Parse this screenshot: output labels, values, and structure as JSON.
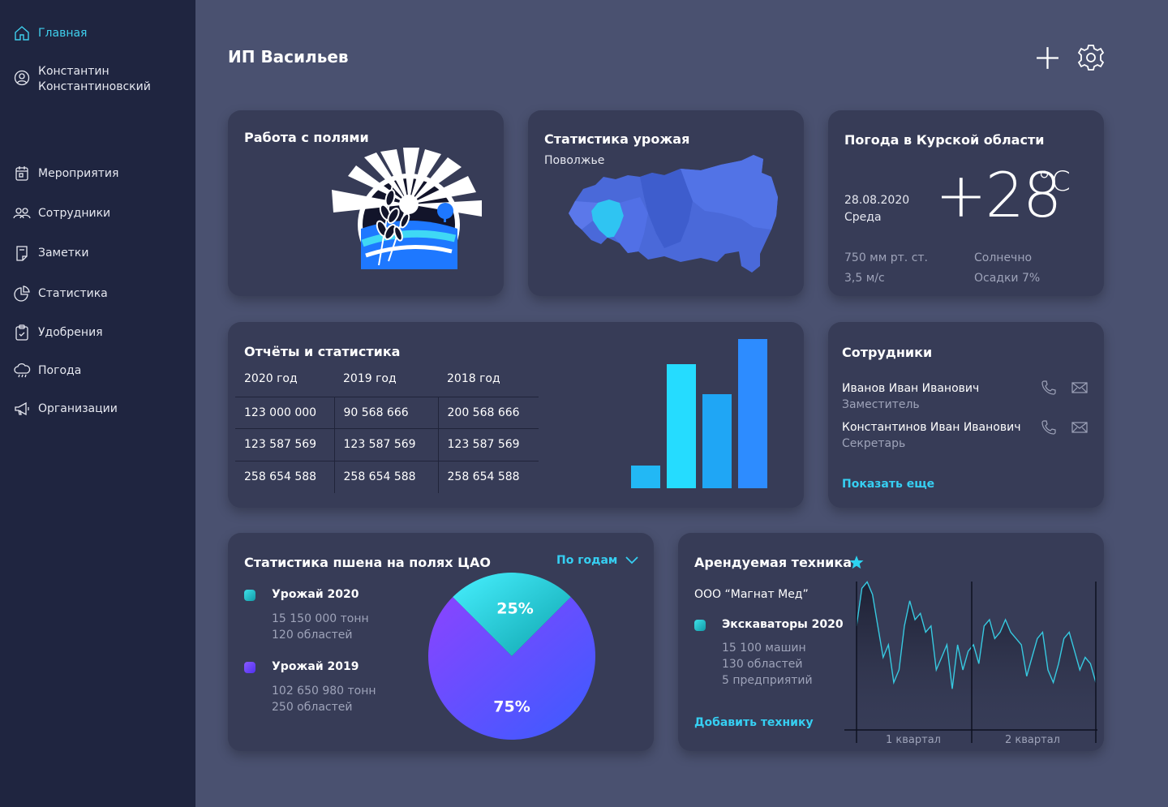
{
  "sidebar": {
    "home": "Главная",
    "user_line1": "Константин",
    "user_line2": "Константиновский",
    "items": [
      {
        "label": "Мероприятия"
      },
      {
        "label": "Сотрудники"
      },
      {
        "label": "Заметки"
      },
      {
        "label": "Статистика"
      },
      {
        "label": "Удобрения"
      },
      {
        "label": "Погода"
      },
      {
        "label": "Организации"
      }
    ]
  },
  "header": {
    "title": "ИП Васильев",
    "add_icon": "plus-icon",
    "settings_icon": "gear-icon"
  },
  "fields_card": {
    "title": "Работа с полями"
  },
  "harvest_card": {
    "title": "Статистика урожая",
    "region": "Поволжье"
  },
  "weather_card": {
    "title": "Погода в Курской области",
    "date": "28.08.2020",
    "weekday": "Среда",
    "temperature": "+28",
    "unit": "°C",
    "pressure": "750 мм рт. ст.",
    "wind": "3,5 м/с",
    "condition": "Солнечно",
    "precipitation": "Осадки 7%"
  },
  "reports_card": {
    "title": "Отчёты и статистика",
    "columns": [
      "2020 год",
      "2019 год",
      "2018 год"
    ],
    "rows": [
      [
        "123 000 000",
        "90 568 666",
        "200 568 666"
      ],
      [
        "123 587 569",
        "123 587 569",
        "123 587 569"
      ],
      [
        "258 654 588",
        "258 654 588",
        "258 654 588"
      ]
    ],
    "bar_chart": {
      "values": [
        28,
        153,
        116,
        184
      ],
      "max": 184,
      "colors": [
        "#22b8f5",
        "#25dcff",
        "#1fa6f5",
        "#2d8cff"
      ]
    }
  },
  "employees_card": {
    "title": "Сотрудники",
    "list": [
      {
        "name": "Иванов Иван Иванович",
        "role": "Заместитель"
      },
      {
        "name": "Константинов Иван Иванович",
        "role": "Секретарь"
      }
    ],
    "more": "Показать еще"
  },
  "millet_card": {
    "title": "Статистика пшена на полях ЦАО",
    "filter": "По годам",
    "legend": [
      {
        "name": "Урожай 2020",
        "line1": "15 150 000 тонн",
        "line2": "120 областей",
        "color": "#1fc6c9"
      },
      {
        "name": "Урожай 2019",
        "line1": "102 650 980 тонн",
        "line2": "250 областей",
        "color": "#6a44ff"
      }
    ],
    "chart_data": {
      "type": "pie",
      "slices": [
        {
          "label": "25%",
          "value": 25,
          "color": "#1fd0d8"
        },
        {
          "label": "75%",
          "value": 75,
          "color": "#5a4dff"
        }
      ]
    }
  },
  "rental_card": {
    "title": "Арендуемая техника",
    "star_icon": "star-icon",
    "company": "ООО “Магнат Мед”",
    "item": "Экскаваторы 2020",
    "line1": "15 100 машин",
    "line2": "130 областей",
    "line3": "5 предприятий",
    "add": "Добавить технику",
    "chart_data": {
      "type": "line",
      "x_labels": [
        "1 квартал",
        "2 квартал"
      ],
      "values": [
        55,
        85,
        90,
        80,
        55,
        30,
        40,
        10,
        20,
        55,
        75,
        60,
        65,
        50,
        55,
        20,
        30,
        40,
        5,
        40,
        20,
        35,
        40,
        25,
        55,
        60,
        45,
        50,
        60,
        50,
        45,
        40,
        15,
        30,
        45,
        50,
        20,
        10,
        25,
        45,
        50,
        35,
        20,
        30,
        25,
        10
      ]
    }
  }
}
